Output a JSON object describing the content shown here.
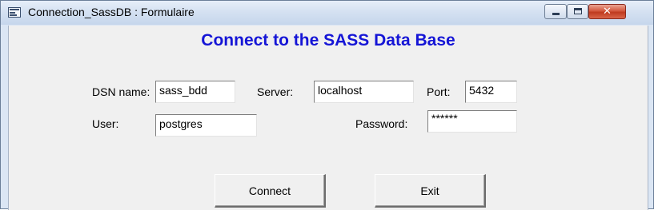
{
  "window": {
    "title": "Connection_SassDB : Formulaire",
    "close_glyph": "✕"
  },
  "form": {
    "heading": "Connect to the SASS Data Base",
    "fields": {
      "dsn": {
        "label": "DSN name:",
        "value": "sass_bdd"
      },
      "server": {
        "label": "Server:",
        "value": "localhost"
      },
      "port": {
        "label": "Port:",
        "value": "5432"
      },
      "user": {
        "label": "User:",
        "value": "postgres"
      },
      "password": {
        "label": "Password:",
        "value": "******"
      }
    },
    "buttons": {
      "connect": "Connect",
      "exit": "Exit"
    }
  }
}
